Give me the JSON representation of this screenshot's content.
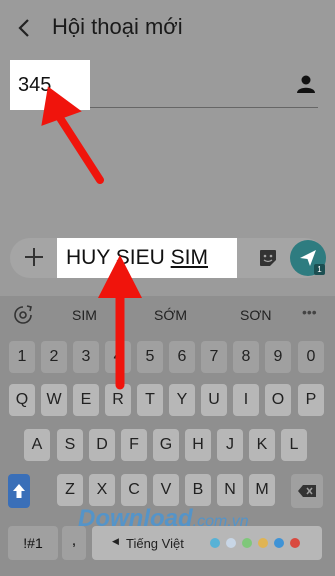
{
  "header": {
    "title": "Hội thoại mới"
  },
  "recipient": {
    "value": "345"
  },
  "composer": {
    "text_part1": "HUY SIEU ",
    "text_part2": "SIM",
    "send_badge": "1"
  },
  "suggestions": [
    "SIM",
    "SỚM",
    "SƠN"
  ],
  "keyboard": {
    "row_numbers": [
      "1",
      "2",
      "3",
      "4",
      "5",
      "6",
      "7",
      "8",
      "9",
      "0"
    ],
    "row_1": [
      "Q",
      "W",
      "E",
      "R",
      "T",
      "Y",
      "U",
      "I",
      "O",
      "P"
    ],
    "row_2": [
      "A",
      "S",
      "D",
      "F",
      "G",
      "H",
      "J",
      "K",
      "L"
    ],
    "row_3": [
      "Z",
      "X",
      "C",
      "V",
      "B",
      "N",
      "M"
    ],
    "sym_label": "!#1",
    "comma_label": ",",
    "space_label": "Tiếng Việt"
  },
  "watermark": {
    "brand": "Download",
    "suffix": ".com.vn"
  },
  "colors": {
    "annotation_arrow": "#f0140c",
    "send_button": "#2e7c80",
    "shift_key": "#3a6fb8"
  }
}
